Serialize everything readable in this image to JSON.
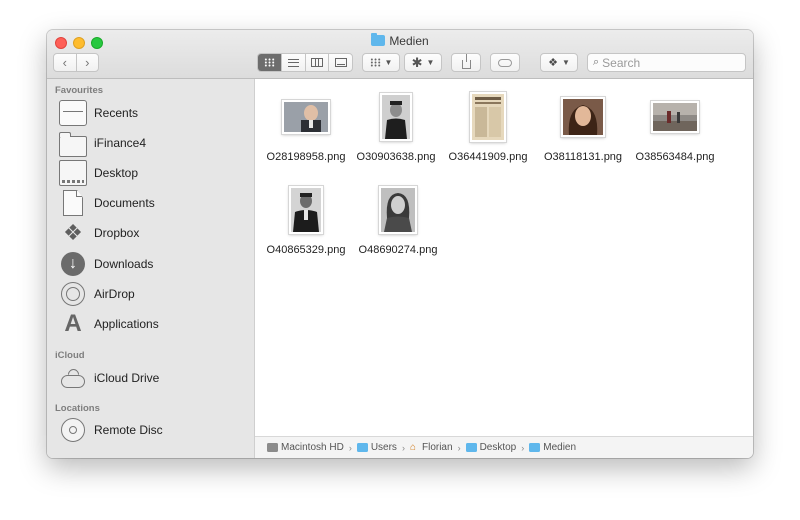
{
  "window": {
    "title": "Medien"
  },
  "toolbar": {
    "back_glyph": "‹",
    "forward_glyph": "›",
    "view_modes": [
      "icon-view",
      "list-view",
      "column-view",
      "gallery-view"
    ],
    "active_view": "icon-view",
    "search": {
      "placeholder": "Search",
      "value": ""
    }
  },
  "sidebar": {
    "sections": {
      "favourites": "Favourites",
      "icloud": "iCloud",
      "locations": "Locations"
    },
    "items": [
      {
        "label": "Recents",
        "icon": "recents-icon"
      },
      {
        "label": "iFinance4",
        "icon": "folder-icon"
      },
      {
        "label": "Desktop",
        "icon": "desktop-icon"
      },
      {
        "label": "Documents",
        "icon": "documents-icon"
      },
      {
        "label": "Dropbox",
        "icon": "dropbox-icon"
      },
      {
        "label": "Downloads",
        "icon": "downloads-icon"
      },
      {
        "label": "AirDrop",
        "icon": "airdrop-icon"
      },
      {
        "label": "Applications",
        "icon": "applications-icon"
      },
      {
        "label": "iCloud Drive",
        "icon": "cloud-icon"
      },
      {
        "label": "Remote Disc",
        "icon": "disc-icon"
      }
    ]
  },
  "files": [
    {
      "name": "O28198958.png",
      "thumb": "portrait-man-suit"
    },
    {
      "name": "O30903638.png",
      "thumb": "portrait-navy-officer"
    },
    {
      "name": "O36441909.png",
      "thumb": "newspaper-clipping"
    },
    {
      "name": "O38118131.png",
      "thumb": "portrait-woman"
    },
    {
      "name": "O38563484.png",
      "thumb": "outdoor-scene"
    },
    {
      "name": "O40865329.png",
      "thumb": "portrait-man-bw"
    },
    {
      "name": "O48690274.png",
      "thumb": "portrait-woman-bw"
    }
  ],
  "pathbar": {
    "crumbs": [
      "Macintosh HD",
      "Users",
      "Florian",
      "Desktop",
      "Medien"
    ],
    "separator": "›"
  },
  "colors": {
    "close": "#fe5f57",
    "minimize": "#febc2e",
    "zoom": "#28c840",
    "folder_accent": "#5fb7ec",
    "sidebar_bg": "#e6e6e6"
  }
}
